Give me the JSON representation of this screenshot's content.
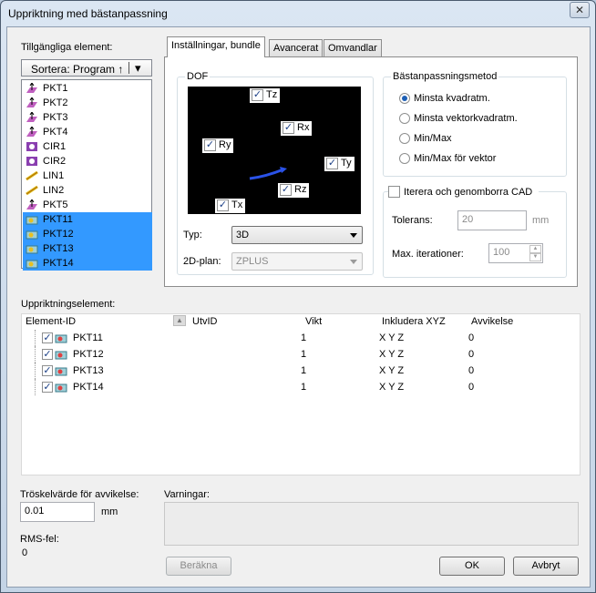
{
  "window": {
    "title": "Uppriktning med bästanpassning",
    "close_glyph": "✕"
  },
  "left": {
    "label": "Tillgängliga element:",
    "sort_label": "Sortera: Program ↑",
    "sort_arrow": "▾",
    "items": [
      {
        "name": "PKT1",
        "icon": "point-icon",
        "selected": false
      },
      {
        "name": "PKT2",
        "icon": "point-icon",
        "selected": false
      },
      {
        "name": "PKT3",
        "icon": "point-icon",
        "selected": false
      },
      {
        "name": "PKT4",
        "icon": "point-icon",
        "selected": false
      },
      {
        "name": "CIR1",
        "icon": "circle-icon",
        "selected": false
      },
      {
        "name": "CIR2",
        "icon": "circle-icon",
        "selected": false
      },
      {
        "name": "LIN1",
        "icon": "line-icon",
        "selected": false
      },
      {
        "name": "LIN2",
        "icon": "line-icon",
        "selected": false
      },
      {
        "name": "PKT5",
        "icon": "point-icon",
        "selected": false
      },
      {
        "name": "PKT11",
        "icon": "point-icon",
        "selected": true
      },
      {
        "name": "PKT12",
        "icon": "point-icon",
        "selected": true
      },
      {
        "name": "PKT13",
        "icon": "point-icon",
        "selected": true
      },
      {
        "name": "PKT14",
        "icon": "point-icon",
        "selected": true
      }
    ]
  },
  "tabs": [
    "Inställningar, bundle",
    "Avancerat",
    "Omvandlar"
  ],
  "dof": {
    "label": "DOF",
    "items": {
      "tz": "Tz",
      "rx": "Rx",
      "ry": "Ry",
      "ty": "Ty",
      "rz": "Rz",
      "tx": "Tx"
    },
    "type_label": "Typ:",
    "type_value": "3D",
    "plane_label": "2D-plan:",
    "plane_value": "ZPLUS"
  },
  "method": {
    "label": "Bästanpassningsmetod",
    "options": [
      "Minsta kvadratm.",
      "Minsta vektorkvadratm.",
      "Min/Max",
      "Min/Max för vektor"
    ],
    "selected_index": 0
  },
  "iterate": {
    "label": "Iterera och genomborra CAD",
    "checked": false,
    "tolerance_label": "Tolerans:",
    "tolerance_value": "20",
    "tolerance_unit": "mm",
    "max_iter_label": "Max. iterationer:",
    "max_iter_value": "100"
  },
  "alignment": {
    "label": "Uppriktningselement:",
    "columns": [
      "Element-ID",
      "UtvID",
      "Vikt",
      "Inkludera XYZ",
      "Avvikelse"
    ],
    "rows": [
      {
        "id": "PKT11",
        "weight": "1",
        "xyz": "X Y Z",
        "dev": "0"
      },
      {
        "id": "PKT12",
        "weight": "1",
        "xyz": "X Y Z",
        "dev": "0"
      },
      {
        "id": "PKT13",
        "weight": "1",
        "xyz": "X Y Z",
        "dev": "0"
      },
      {
        "id": "PKT14",
        "weight": "1",
        "xyz": "X Y Z",
        "dev": "0"
      }
    ]
  },
  "bottom": {
    "threshold_label": "Tröskelvärde för avvikelse:",
    "threshold_value": "0.01",
    "threshold_unit": "mm",
    "warnings_label": "Varningar:",
    "rms_label": "RMS-fel:",
    "rms_value": "0",
    "calc_button": "Beräkna",
    "ok_button": "OK",
    "cancel_button": "Avbryt"
  },
  "colors": {
    "selection": "#3399ff",
    "point_icon": "#c060c0",
    "circle_icon": "#8a3fb0",
    "line_icon": "#e0c020"
  }
}
